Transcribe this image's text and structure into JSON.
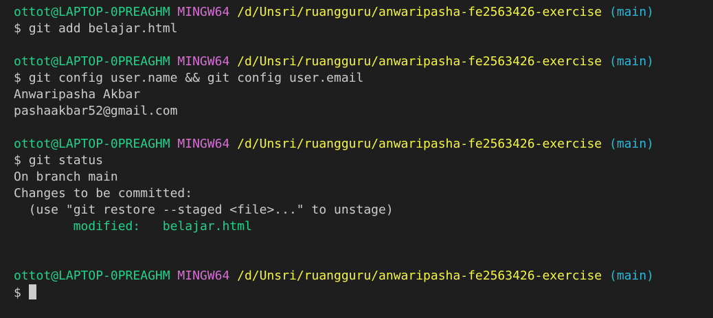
{
  "prompt": {
    "user_host": "ottot@LAPTOP-0PREAGHM",
    "system": "MINGW64",
    "path": "/d/Unsri/ruangguru/anwaripasha-fe2563426-exercise",
    "branch": "(main)",
    "symbol": "$"
  },
  "blocks": [
    {
      "command": "git add belajar.html",
      "output": []
    },
    {
      "command": "git config user.name && git config user.email",
      "output": [
        "Anwaripasha Akbar",
        "pashaakbar52@gmail.com"
      ]
    },
    {
      "command": "git status",
      "output": [
        "On branch main",
        "Changes to be committed:",
        "  (use \"git restore --staged <file>...\" to unstage)"
      ],
      "modified_label": "modified:",
      "modified_file": "belajar.html"
    }
  ],
  "colors": {
    "background": "#1e1e1e",
    "text": "#cccccc",
    "user_host": "#23d18b",
    "system": "#d670d6",
    "path": "#f5f543",
    "branch": "#29b8db"
  }
}
